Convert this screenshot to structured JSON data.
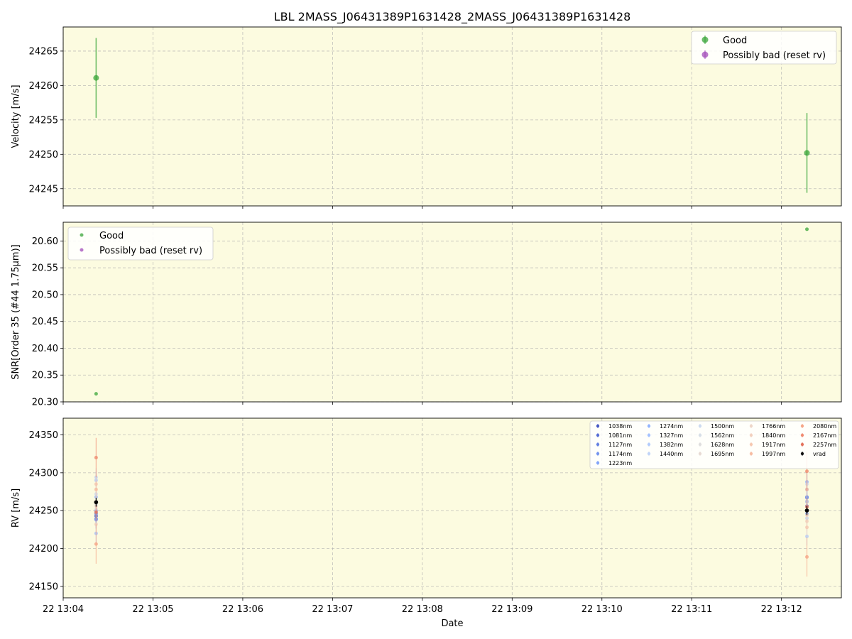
{
  "figure": {
    "title": "LBL 2MASS_J06431389P1631428_2MASS_J06431389P1631428",
    "background_color": "#ffffff",
    "panel_background": "#fcfbe0"
  },
  "chart_data": [
    {
      "type": "scatter",
      "id": "velocity",
      "ylabel": "Velocity [m/s]",
      "xlabel": "",
      "xlim": [
        "22 13:04:00",
        "22 13:12:40"
      ],
      "ylim": [
        24242.5,
        24268.5
      ],
      "yticks": [
        24245,
        24250,
        24255,
        24260,
        24265
      ],
      "grid": true,
      "legend_placement": "top-right",
      "series": [
        {
          "name": "Good",
          "color": "#2ca02c",
          "marker": "errorbar",
          "points": [
            {
              "x": "22 13:04:22",
              "y": 24261.1,
              "err": 5.8
            },
            {
              "x": "22 13:12:17",
              "y": 24250.2,
              "err": 5.8
            }
          ]
        },
        {
          "name": "Possibly bad (reset rv)",
          "color": "#9b3fb5",
          "marker": "errorbar",
          "points": []
        }
      ]
    },
    {
      "type": "scatter",
      "id": "snr",
      "ylabel": "SNR[Order 35 (#44 1.75μm)]",
      "xlabel": "",
      "xlim": [
        "22 13:04:00",
        "22 13:12:40"
      ],
      "ylim": [
        20.3,
        20.635
      ],
      "yticks": [
        "20.30",
        "20.35",
        "20.40",
        "20.45",
        "20.50",
        "20.55",
        "20.60"
      ],
      "grid": true,
      "legend_placement": "top-left",
      "series": [
        {
          "name": "Good",
          "color": "#2ca02c",
          "marker": "dot",
          "points": [
            {
              "x": "22 13:04:22",
              "y": 20.315
            },
            {
              "x": "22 13:12:17",
              "y": 20.622
            }
          ]
        },
        {
          "name": "Possibly bad (reset rv)",
          "color": "#9b3fb5",
          "marker": "dot",
          "points": []
        }
      ]
    },
    {
      "type": "scatter",
      "id": "rv",
      "ylabel": "RV [m/s]",
      "xlabel": "Date",
      "xlim": [
        "22 13:04:00",
        "22 13:12:40"
      ],
      "ylim": [
        24135,
        24372
      ],
      "yticks": [
        24150,
        24200,
        24250,
        24300,
        24350
      ],
      "xticks": [
        "22 13:04",
        "22 13:05",
        "22 13:06",
        "22 13:07",
        "22 13:08",
        "22 13:09",
        "22 13:10",
        "22 13:11",
        "22 13:12"
      ],
      "grid": true,
      "legend_placement": "top-right",
      "legend_columns": 5,
      "series": [
        {
          "name": "1038nm",
          "color": "#3b4cc0",
          "values": [
            24243,
            24256
          ]
        },
        {
          "name": "1081nm",
          "color": "#4a63d3",
          "values": [
            24239,
            24262
          ]
        },
        {
          "name": "1127nm",
          "color": "#5a78e0",
          "values": [
            24246,
            24268
          ]
        },
        {
          "name": "1174nm",
          "color": "#6b8ded",
          "values": [
            24250,
            24267
          ]
        },
        {
          "name": "1223nm",
          "color": "#7b9ff9",
          "values": [
            24238,
            24246
          ]
        },
        {
          "name": "1274nm",
          "color": "#8db0fe",
          "values": [
            24268,
            24288
          ]
        },
        {
          "name": "1327nm",
          "color": "#9ebeff",
          "values": [
            24220,
            24278
          ]
        },
        {
          "name": "1382nm",
          "color": "#aec9fc",
          "values": [
            24290,
            24216
          ]
        },
        {
          "name": "1440nm",
          "color": "#bcd2f7",
          "values": [
            24294,
            24240
          ]
        },
        {
          "name": "1500nm",
          "color": "#c9d7f0",
          "values": [
            24272,
            24285
          ]
        },
        {
          "name": "1562nm",
          "color": "#d4dbe6",
          "values": [
            24258,
            24262
          ]
        },
        {
          "name": "1628nm",
          "color": "#dddcdc",
          "values": [
            24252,
            24255
          ]
        },
        {
          "name": "1695nm",
          "color": "#e5d8d1",
          "values": [
            24262,
            24250
          ]
        },
        {
          "name": "1766nm",
          "color": "#ecd3c5",
          "values": [
            24256,
            24244
          ]
        },
        {
          "name": "1840nm",
          "color": "#f1cdba",
          "values": [
            24232,
            24236
          ]
        },
        {
          "name": "1917nm",
          "color": "#f5c4ac",
          "values": [
            24285,
            24228
          ]
        },
        {
          "name": "1997nm",
          "color": "#f6b89c",
          "values": [
            24278,
            24278
          ]
        },
        {
          "name": "2080nm",
          "color": "#f5a081",
          "values": [
            24206,
            24189
          ]
        },
        {
          "name": "2167nm",
          "color": "#ee8468",
          "values": [
            24320,
            24302
          ]
        },
        {
          "name": "2257nm",
          "color": "#e26952",
          "values": [
            24248,
            24255
          ]
        },
        {
          "name": "vrad",
          "color": "#000000",
          "values": [
            24261.1,
            24250.2
          ]
        }
      ],
      "x": [
        "22 13:04:22",
        "22 13:12:17"
      ]
    }
  ]
}
